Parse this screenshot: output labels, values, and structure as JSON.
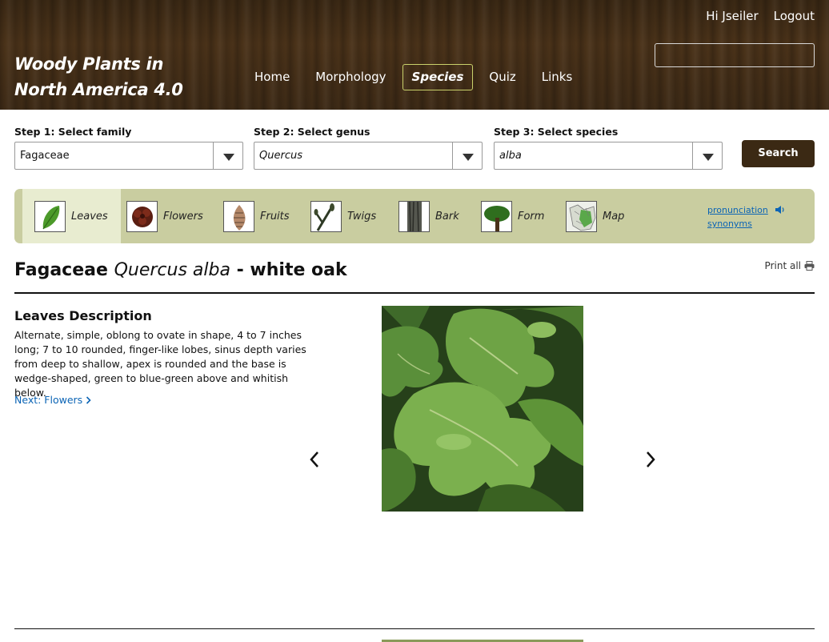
{
  "header": {
    "title_line1": "Woody Plants in",
    "title_line2": "North America 4.0",
    "user_greeting": "Hi Jseiler",
    "logout_label": "Logout",
    "search_placeholder": ""
  },
  "nav": {
    "items": [
      {
        "label": "Home"
      },
      {
        "label": "Morphology"
      },
      {
        "label": "Species",
        "active": true
      },
      {
        "label": "Quiz"
      },
      {
        "label": "Links"
      }
    ]
  },
  "steps": {
    "family_label": "Step 1: Select family",
    "family_value": "Fagaceae",
    "genus_label": "Step 2: Select genus",
    "genus_value": "Quercus",
    "species_label": "Step 3: Select species",
    "species_value": "alba",
    "search_label": "Search"
  },
  "tabs": {
    "items": [
      {
        "label": "Leaves",
        "icon": "leaf-icon",
        "active": true
      },
      {
        "label": "Flowers",
        "icon": "flower-icon"
      },
      {
        "label": "Fruits",
        "icon": "fruit-icon"
      },
      {
        "label": "Twigs",
        "icon": "twig-icon"
      },
      {
        "label": "Bark",
        "icon": "bark-icon"
      },
      {
        "label": "Form",
        "icon": "tree-icon"
      },
      {
        "label": "Map",
        "icon": "map-icon"
      }
    ],
    "pronunciation_label": "pronunciation",
    "synonyms_label": "synonyms"
  },
  "species": {
    "family": "Fagaceae",
    "binomial": "Quercus alba",
    "common_suffix": " - white oak",
    "print_all_label": "Print all"
  },
  "description": {
    "title": "Leaves Description",
    "text": "Alternate, simple, oblong to ovate in shape, 4 to 7 inches long; 7 to 10 rounded, finger-like lobes, sinus depth varies from deep to shallow, apex is rounded and the base is wedge-shaped, green to blue-green above and whitish below.",
    "next_label": "Next: Flowers"
  },
  "colors": {
    "header_brown": "#3a2814",
    "nav_active_border": "#c9d16b",
    "tabbar_bg": "#c9cda0",
    "link_blue": "#0b64b5",
    "search_button": "#3b2914"
  }
}
